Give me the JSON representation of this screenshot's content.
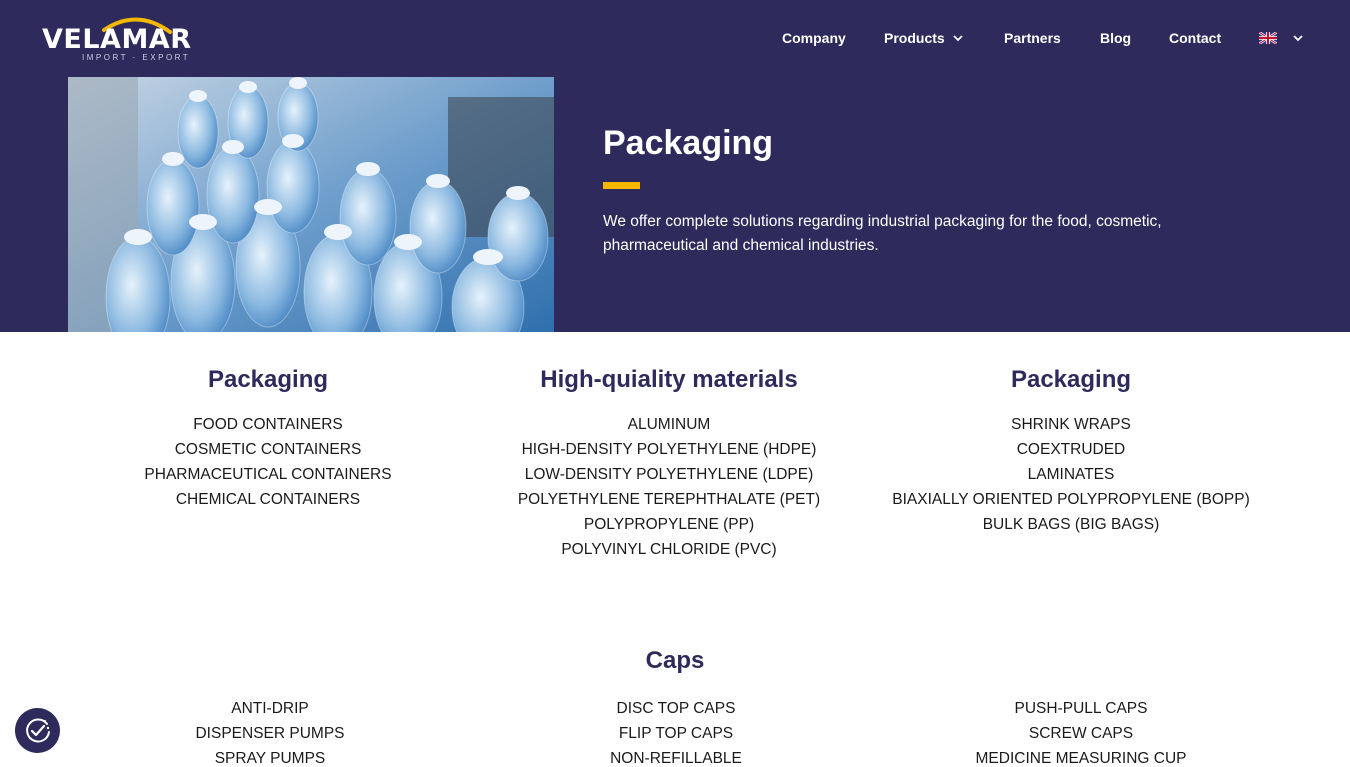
{
  "brand": {
    "name": "VELAMAR",
    "tagline": "IMPORT · EXPORT"
  },
  "nav": {
    "company": "Company",
    "products": "Products",
    "partners": "Partners",
    "blog": "Blog",
    "contact": "Contact",
    "language_icon": "uk-flag-icon"
  },
  "hero": {
    "title": "Packaging",
    "description": "We offer complete solutions regarding industrial packaging for the food, cosmetic, pharmaceutical and chemical industries."
  },
  "sections": [
    {
      "title": "Packaging",
      "items": [
        "FOOD CONTAINERS",
        "COSMETIC CONTAINERS",
        "PHARMACEUTICAL CONTAINERS",
        "CHEMICAL CONTAINERS"
      ]
    },
    {
      "title": "High-quiality materials",
      "items": [
        "ALUMINUM",
        "HIGH-DENSITY POLYETHYLENE (HDPE)",
        "LOW-DENSITY POLYETHYLENE (LDPE)",
        "POLYETHYLENE TEREPHTHALATE (PET)",
        "POLYPROPYLENE (PP)",
        "POLYVINYL CHLORIDE (PVC)"
      ]
    },
    {
      "title": "Packaging",
      "items": [
        "SHRINK WRAPS",
        "COEXTRUDED",
        "LAMINATES",
        "BIAXIALLY ORIENTED POLYPROPYLENE (BOPP)",
        "BULK BAGS (BIG BAGS)"
      ]
    }
  ],
  "caps": {
    "title": "Caps",
    "columns": [
      [
        "ANTI-DRIP",
        "DISPENSER PUMPS",
        "SPRAY PUMPS"
      ],
      [
        "DISC TOP CAPS",
        "FLIP TOP CAPS",
        "NON-REFILLABLE"
      ],
      [
        "PUSH-PULL CAPS",
        "SCREW CAPS",
        "MEDICINE MEASURING CUP"
      ]
    ]
  },
  "colors": {
    "primary": "#2e2a5b",
    "accent": "#f5b800",
    "text": "#1a1a1a"
  }
}
